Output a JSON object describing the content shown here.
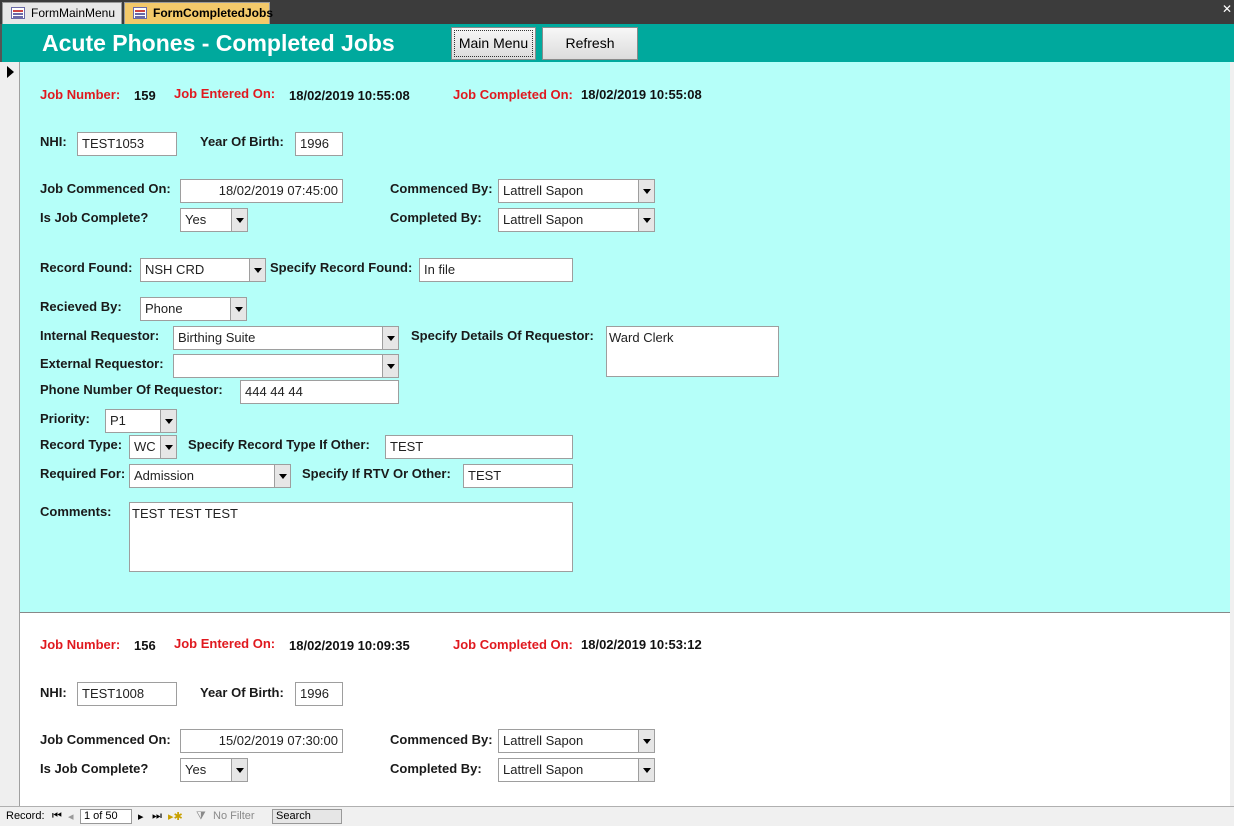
{
  "tabs": [
    {
      "label": "FormMainMenu",
      "active": false
    },
    {
      "label": "FormCompletedJobs",
      "active": true
    }
  ],
  "header": {
    "title": "Acute Phones - Completed Jobs",
    "main_menu_label": "Main Menu",
    "refresh_label": "Refresh",
    "color": "#00a99d"
  },
  "labels": {
    "job_number": "Job Number:",
    "job_entered_on": "Job Entered On:",
    "job_completed_on": "Job Completed On:",
    "nhi": "NHI:",
    "year_of_birth": "Year Of Birth:",
    "job_commenced_on": "Job Commenced On:",
    "commenced_by": "Commenced By:",
    "is_job_complete": "Is Job Complete?",
    "completed_by": "Completed By:",
    "record_found": "Record Found:",
    "specify_record_found": "Specify Record Found:",
    "recieved_by": "Recieved By:",
    "internal_requestor": "Internal Requestor:",
    "specify_details_of_requestor": "Specify Details Of Requestor:",
    "external_requestor": "External Requestor:",
    "phone_number_of_requestor": "Phone Number Of Requestor:",
    "priority": "Priority:",
    "record_type": "Record Type:",
    "specify_record_type_if_other": "Specify Record Type If Other:",
    "required_for": "Required For:",
    "specify_if_rtv_or_other": "Specify If RTV Or Other:",
    "comments": "Comments:"
  },
  "records": [
    {
      "job_number": "159",
      "job_entered_on": "18/02/2019 10:55:08",
      "job_completed_on": "18/02/2019 10:55:08",
      "nhi": "TEST1053",
      "year_of_birth": "1996",
      "job_commenced_on": "18/02/2019 07:45:00",
      "commenced_by": "Lattrell Sapon",
      "is_job_complete": "Yes",
      "completed_by": "Lattrell Sapon",
      "record_found": "NSH CRD",
      "specify_record_found": "In file",
      "recieved_by": "Phone",
      "internal_requestor": "Birthing Suite",
      "specify_details_of_requestor": "Ward Clerk",
      "external_requestor": "",
      "phone_number_of_requestor": "444 44 44",
      "priority": "P1",
      "record_type": "WC",
      "specify_record_type_if_other": "TEST",
      "required_for": "Admission",
      "specify_if_rtv_or_other": "TEST",
      "comments": "TEST TEST TEST"
    },
    {
      "job_number": "156",
      "job_entered_on": "18/02/2019 10:09:35",
      "job_completed_on": "18/02/2019 10:53:12",
      "nhi": "TEST1008",
      "year_of_birth": "1996",
      "job_commenced_on": "15/02/2019 07:30:00",
      "commenced_by": "Lattrell Sapon",
      "is_job_complete": "Yes",
      "completed_by": "Lattrell Sapon"
    }
  ],
  "navbar": {
    "record_label": "Record:",
    "position": "1 of 50",
    "filter_label": "No Filter",
    "search_label": "Search"
  },
  "colors": {
    "current_record_bg": "#b5fff9",
    "label_red": "#e0191f"
  }
}
